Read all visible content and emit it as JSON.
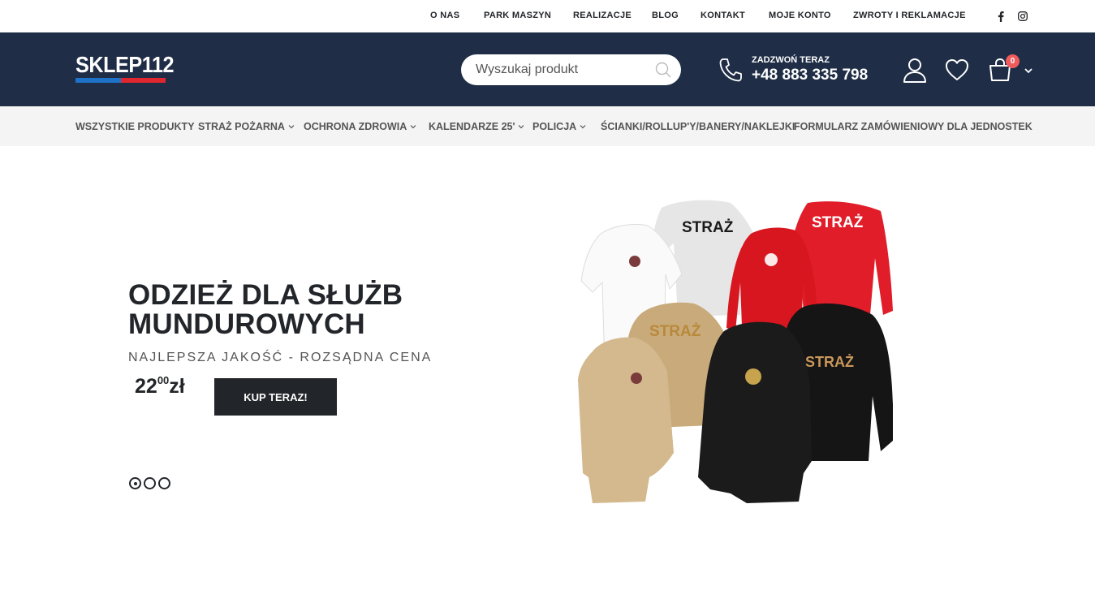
{
  "top_links": [
    "O NAS",
    "PARK MASZYN",
    "REALIZACJE",
    "BLOG",
    "KONTAKT",
    "MOJE KONTO",
    "ZWROTY I REKLAMACJE"
  ],
  "social_icons": [
    "facebook-icon",
    "instagram-icon"
  ],
  "header": {
    "logo_text": "SKLEP112",
    "search_placeholder": "Wyszukaj produkt",
    "call_label": "ZADZWOŃ TERAZ",
    "call_number": "+48 883 335 798",
    "cart_count": "0",
    "colors": {
      "background": "#1f2e46",
      "logo_blue": "#1e73c8",
      "logo_red": "#e0262f",
      "badge": "#f15b5b"
    }
  },
  "nav": [
    {
      "label": "WSZYSTKIE PRODUKTY",
      "dropdown": false
    },
    {
      "label": "STRAŻ POŻARNA",
      "dropdown": true
    },
    {
      "label": "OCHRONA ZDROWIA",
      "dropdown": true
    },
    {
      "label": "KALENDARZE 25'",
      "dropdown": true
    },
    {
      "label": "POLICJA",
      "dropdown": true
    },
    {
      "label": "ŚCIANKI/ROLLUP'Y/BANERY/NAKLEJKI",
      "dropdown": false
    },
    {
      "label": "FORMULARZ ZAMÓWIENIOWY DLA JEDNOSTEK",
      "dropdown": false
    }
  ],
  "hero": {
    "title": "ODZIEŻ DLA SŁUŻB MUNDUROWYCH",
    "subtitle": "NAJLEPSZA JAKOŚĆ - ROZSĄDNA CENA",
    "price_int": "22",
    "price_dec": "00",
    "price_currency": "zł",
    "button_label": "KUP TERAZ!",
    "slides_count": 3,
    "active_slide": 1,
    "garment_texts": [
      "STRAŻ",
      "STRAŻ",
      "STRAŻ",
      "STRAŻ"
    ]
  }
}
